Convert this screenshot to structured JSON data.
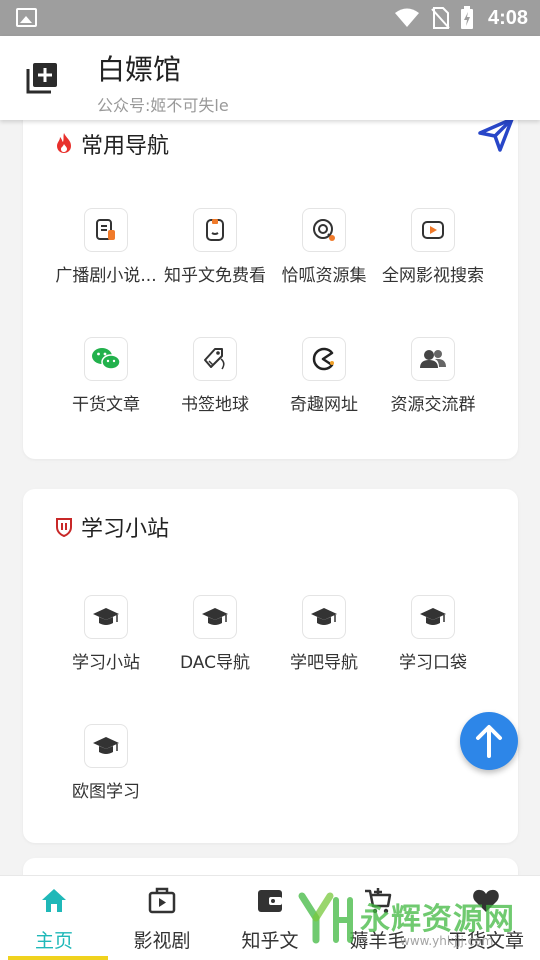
{
  "status_bar": {
    "time": "4:08"
  },
  "header": {
    "title": "白嫖馆",
    "subtitle": "公众号:姬不可失le"
  },
  "nav_section": {
    "title": "常用导航",
    "items": [
      {
        "label": "广播剧小说...",
        "icon": "audio-drama-icon"
      },
      {
        "label": "知乎文免费看",
        "icon": "zhihu-icon"
      },
      {
        "label": "恰呱资源集",
        "icon": "resource-icon"
      },
      {
        "label": "全网影视搜索",
        "icon": "video-play-icon"
      },
      {
        "label": "干货文章",
        "icon": "wechat-icon"
      },
      {
        "label": "书签地球",
        "icon": "bookmark-tag-icon"
      },
      {
        "label": "奇趣网址",
        "icon": "pacman-icon"
      },
      {
        "label": "资源交流群",
        "icon": "group-icon"
      }
    ]
  },
  "study_section": {
    "title": "学习小站",
    "items": [
      {
        "label": "学习小站",
        "icon": "graduation-cap-icon"
      },
      {
        "label": "DAC导航",
        "icon": "graduation-cap-icon"
      },
      {
        "label": "学吧导航",
        "icon": "graduation-cap-icon"
      },
      {
        "label": "学习口袋",
        "icon": "graduation-cap-icon"
      },
      {
        "label": "欧图学习",
        "icon": "graduation-cap-icon"
      }
    ]
  },
  "bottom_nav": {
    "items": [
      {
        "label": "主页",
        "icon": "home-icon",
        "active": true
      },
      {
        "label": "影视剧",
        "icon": "video-icon",
        "active": false
      },
      {
        "label": "知乎文",
        "icon": "wallet-icon",
        "active": false
      },
      {
        "label": "薅羊毛",
        "icon": "cart-icon",
        "active": false
      },
      {
        "label": "干货文章",
        "icon": "heart-icon",
        "active": false
      }
    ]
  },
  "watermark": {
    "text": "永辉资源网",
    "url": "www.yhkjjj.com"
  },
  "colors": {
    "accent": "#1fb8b8",
    "fab": "#2d86e8",
    "nav_underline": "#f0d21e",
    "send_icon": "#2846c8"
  }
}
